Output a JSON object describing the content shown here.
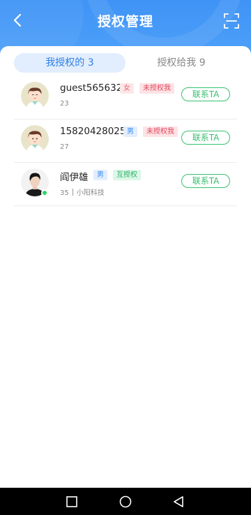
{
  "header": {
    "title": "授权管理",
    "back_icon": "chevron-left-icon",
    "scan_icon": "scan-icon",
    "color": "#4a9bf7"
  },
  "tabs": [
    {
      "label": "我授权的 3",
      "active": true
    },
    {
      "label": "授权给我 9",
      "active": false
    }
  ],
  "users": [
    {
      "name": "guest565632",
      "gender": "女",
      "status": "未授权我",
      "age": "23",
      "company": "",
      "contact_label": "联系TA",
      "avatar": "cartoon-boy-avatar"
    },
    {
      "name": "15820428025",
      "gender": "男",
      "status": "未授权我",
      "age": "27",
      "company": "",
      "contact_label": "联系TA",
      "avatar": "cartoon-boy-avatar"
    },
    {
      "name": "阎伊雄",
      "gender": "男",
      "status": "互授权",
      "age": "35",
      "company": "小阳科技",
      "contact_label": "联系TA",
      "avatar": "photo-avatar",
      "online": true
    }
  ],
  "system_nav": {
    "icons": [
      "recent-apps-icon",
      "home-icon",
      "back-triangle-icon"
    ]
  }
}
